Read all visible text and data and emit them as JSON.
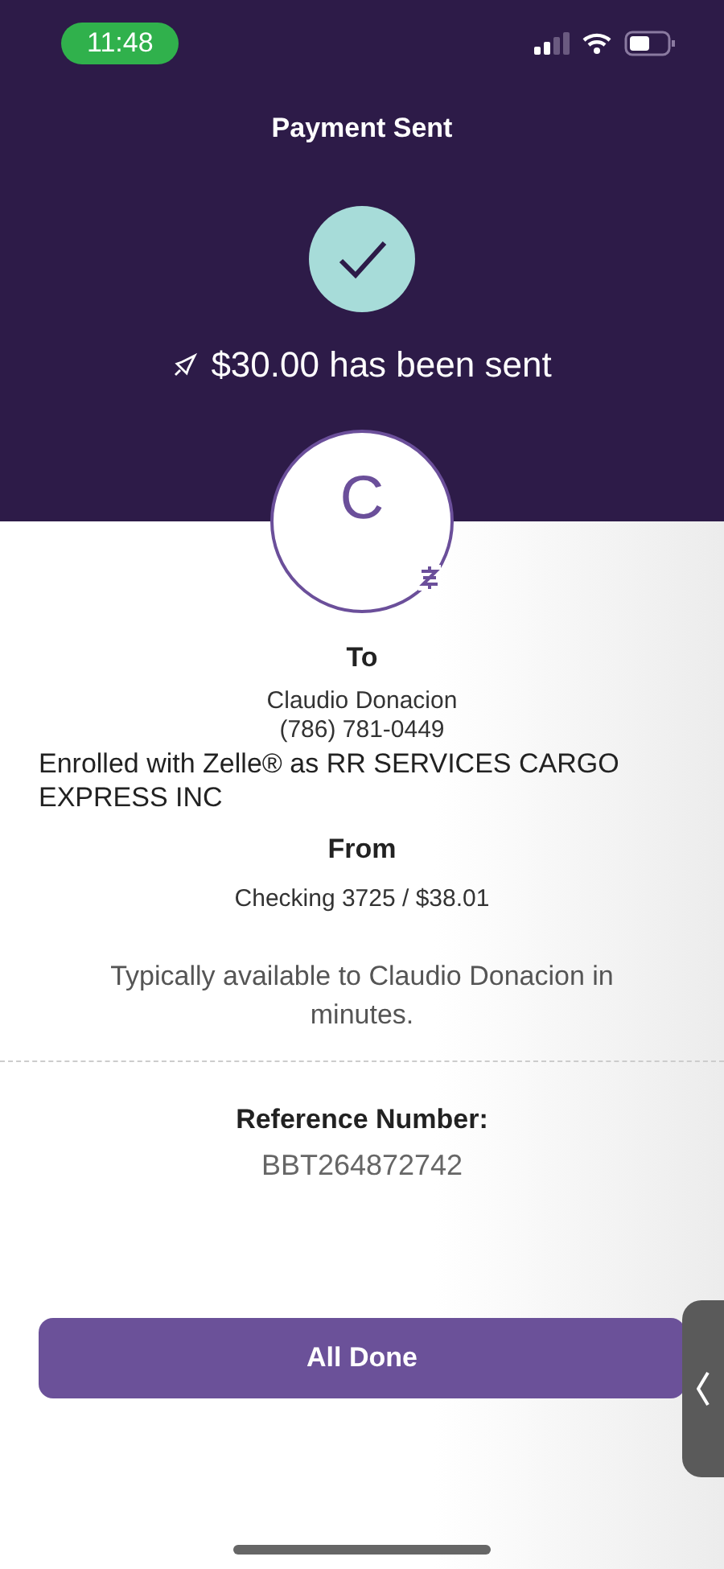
{
  "status_bar": {
    "time": "11:48"
  },
  "header": {
    "title": "Payment Sent",
    "message": "$30.00 has been sent"
  },
  "recipient": {
    "initial": "C",
    "to_label": "To",
    "name": "Claudio Donacion",
    "phone": "(786) 781-0449",
    "enrolled": "Enrolled with Zelle® as RR SERVICES CARGO EXPRESS INC"
  },
  "source": {
    "from_label": "From",
    "account": "Checking 3725 / $38.01"
  },
  "note": "Typically available to Claudio Donacion in minutes.",
  "reference": {
    "label": "Reference Number:",
    "number": "BBT264872742"
  },
  "button": {
    "label": "All Done"
  }
}
